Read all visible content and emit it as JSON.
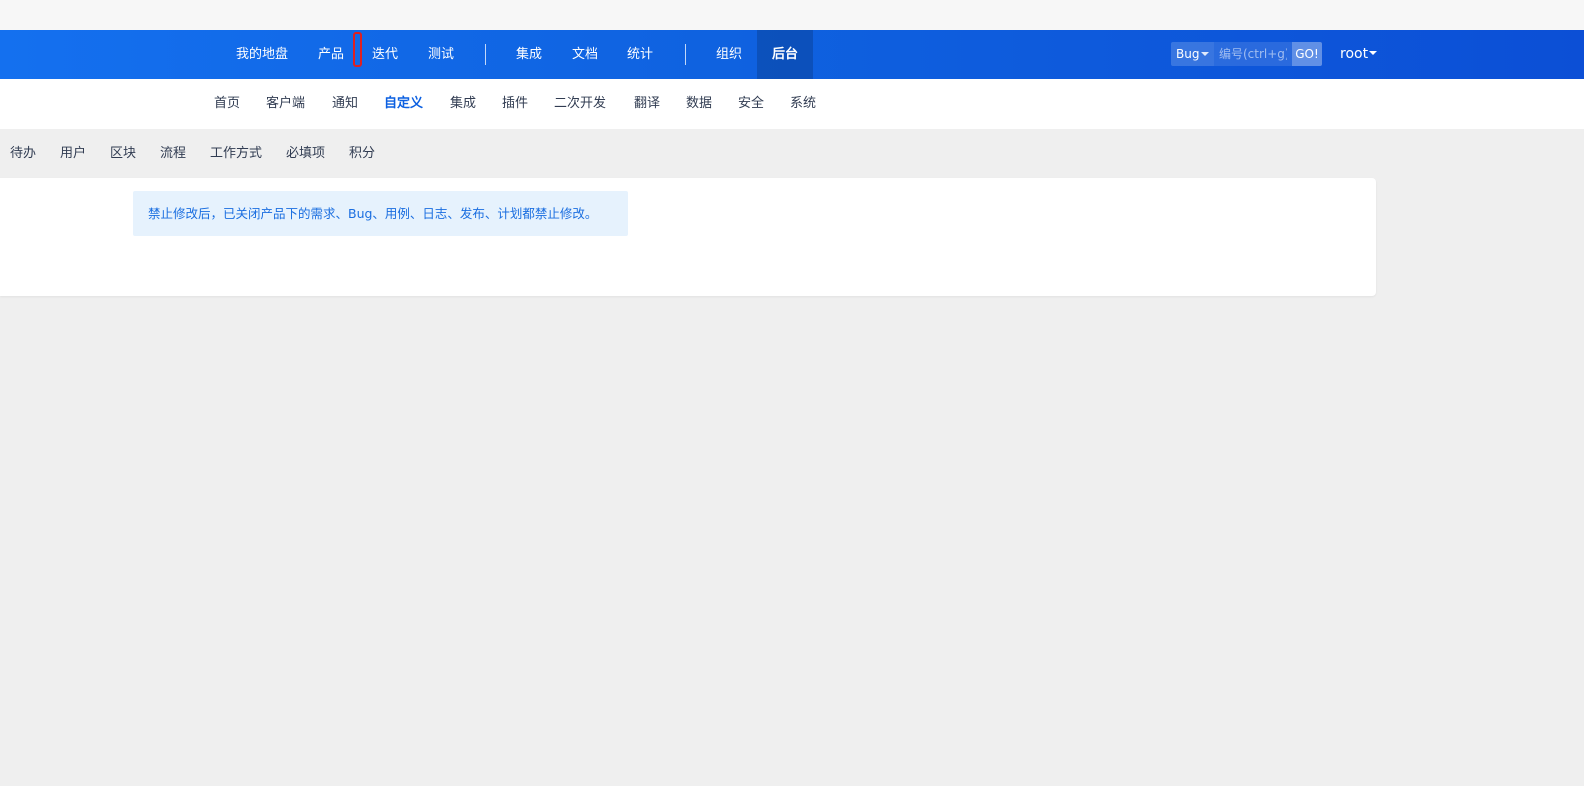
{
  "header": {
    "nav_items": [
      {
        "label": "我的地盘"
      },
      {
        "label": "产品"
      },
      {
        "label": "迭代"
      },
      {
        "label": "测试"
      },
      {
        "label": "集成"
      },
      {
        "label": "文档"
      },
      {
        "label": "统计"
      },
      {
        "label": "组织"
      },
      {
        "label": "后台",
        "active": true
      }
    ],
    "search": {
      "type_label": "Bug",
      "placeholder": "编号(ctrl+g)",
      "go_label": "GO!"
    },
    "user_label": "root"
  },
  "subnav": {
    "items": [
      {
        "label": "首页"
      },
      {
        "label": "客户端"
      },
      {
        "label": "通知"
      },
      {
        "label": "自定义",
        "active": true
      },
      {
        "label": "集成"
      },
      {
        "label": "插件"
      },
      {
        "label": "二次开发"
      },
      {
        "label": "翻译"
      },
      {
        "label": "数据"
      },
      {
        "label": "安全"
      },
      {
        "label": "系统"
      }
    ]
  },
  "tabs": {
    "items": [
      {
        "label": "待办"
      },
      {
        "label": "用户"
      },
      {
        "label": "区块"
      },
      {
        "label": "流程"
      },
      {
        "label": "工作方式"
      },
      {
        "label": "必填项"
      },
      {
        "label": "积分"
      }
    ]
  },
  "main": {
    "notice": "禁止修改后，已关闭产品下的需求、Bug、用例、日志、发布、计划都禁止修改。"
  },
  "colors": {
    "navbar": "#0f62e0",
    "active_subnav": "#0c60e1",
    "notice_bg": "#e6f2fd",
    "focus_outline": "#e02020"
  }
}
